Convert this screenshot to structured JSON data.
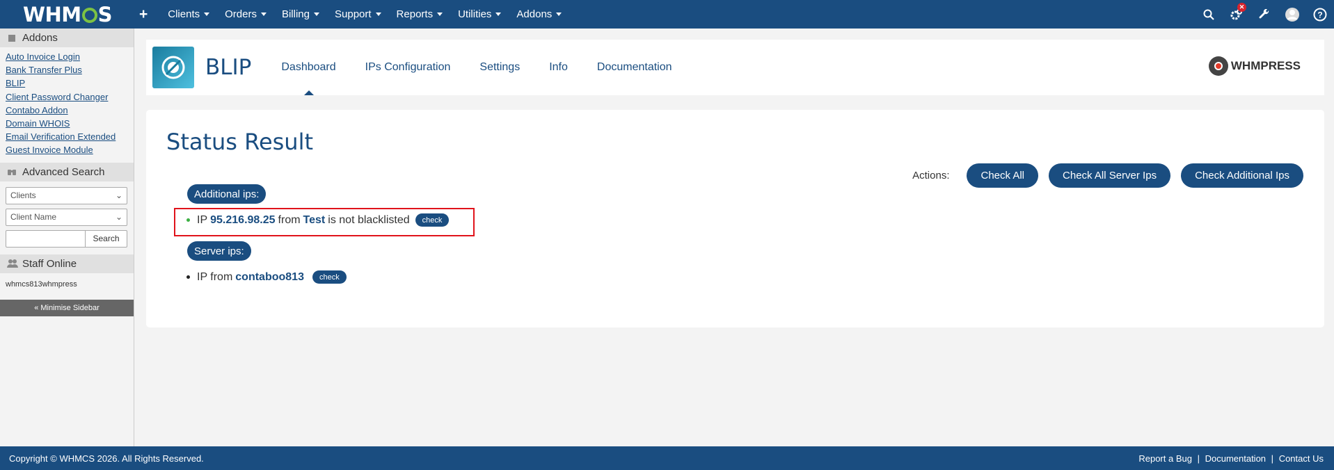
{
  "topbar": {
    "logo": "WHMCS",
    "nav": [
      "Clients",
      "Orders",
      "Billing",
      "Support",
      "Reports",
      "Utilities",
      "Addons"
    ],
    "icons": [
      "search-icon",
      "gear-alert-icon",
      "wrench-icon",
      "user-avatar-icon",
      "help-icon"
    ]
  },
  "sidebar": {
    "addons_heading": "Addons",
    "addons": [
      "Auto Invoice Login",
      "Bank Transfer Plus",
      "BLIP",
      "Client Password Changer",
      "Contabo Addon",
      "Domain WHOIS",
      "Email Verification Extended",
      "Guest Invoice Module"
    ],
    "search_heading": "Advanced Search",
    "search_type": "Clients",
    "search_field": "Client Name",
    "search_button": "Search",
    "staff_heading": "Staff Online",
    "staff_name": "whmcs813whmpress",
    "minimise": "« Minimise Sidebar"
  },
  "module": {
    "title": "BLIP",
    "tabs": [
      "Dashboard",
      "IPs Configuration",
      "Settings",
      "Info",
      "Documentation"
    ],
    "active_tab": "Dashboard",
    "brand": "WHMPRESS"
  },
  "status": {
    "title": "Status Result",
    "actions_label": "Actions:",
    "actions": [
      "Check All",
      "Check All Server Ips",
      "Check Additional Ips"
    ],
    "additional_heading": "Additional ips:",
    "additional": {
      "prefix": "IP",
      "ip": "95.216.98.25",
      "from": "from",
      "source": "Test",
      "status": "is not blacklisted",
      "check": "check",
      "dot_color": "#3cb043"
    },
    "server_heading": "Server ips:",
    "server": {
      "prefix": "IP from",
      "source": "contaboo813",
      "check": "check"
    }
  },
  "footer": {
    "copyright": "Copyright © WHMCS 2026. All Rights Reserved.",
    "links": [
      "Report a Bug",
      "Documentation",
      "Contact Us"
    ],
    "separator": "|"
  }
}
